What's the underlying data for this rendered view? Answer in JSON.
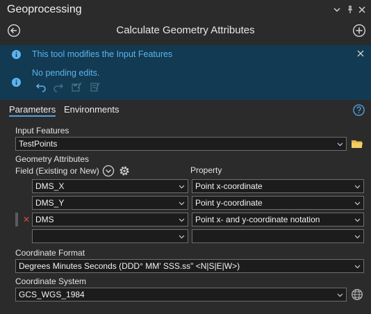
{
  "pane": {
    "title": "Geoprocessing"
  },
  "tool": {
    "title": "Calculate Geometry Attributes"
  },
  "info": {
    "message": "This tool modifies the Input Features",
    "pending": "No pending edits."
  },
  "tabs": [
    {
      "label": "Parameters",
      "active": true
    },
    {
      "label": "Environments",
      "active": false
    }
  ],
  "params": {
    "input_features": {
      "label": "Input Features",
      "value": "TestPoints"
    },
    "geometry_attributes": {
      "label": "Geometry Attributes",
      "field_header": "Field (Existing or New)",
      "property_header": "Property",
      "rows": [
        {
          "field": "DMS_X",
          "property": "Point x-coordinate"
        },
        {
          "field": "DMS_Y",
          "property": "Point y-coordinate"
        },
        {
          "field": "DMS",
          "property": "Point x- and y-coordinate notation"
        },
        {
          "field": "",
          "property": ""
        }
      ]
    },
    "coordinate_format": {
      "label": "Coordinate Format",
      "value": "Degrees Minutes Seconds (DDD° MM' SSS.ss\" <N|S|E|W>)"
    },
    "coordinate_system": {
      "label": "Coordinate System",
      "value": "GCS_WGS_1984"
    }
  },
  "colors": {
    "background": "#2b2b2b",
    "info_panel": "#123a52",
    "info_text": "#5fb3ec",
    "accent": "#4aa3e8",
    "field_bg": "#1c1c1c",
    "delete_x": "#e0493d"
  }
}
